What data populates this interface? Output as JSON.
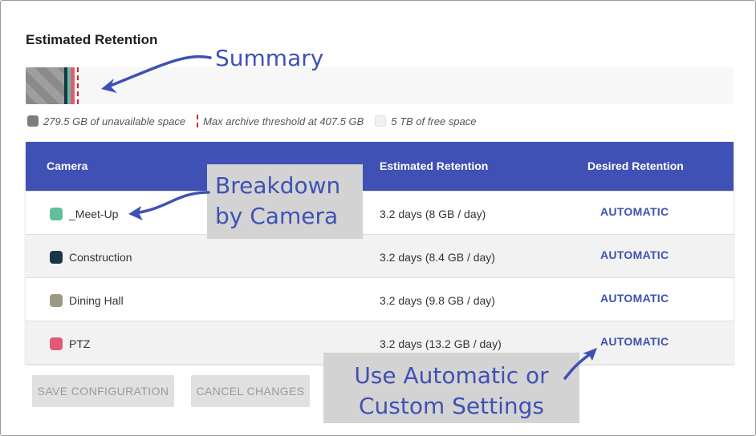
{
  "section_title": "Estimated Retention",
  "legend": {
    "unavailable": "279.5 GB of unavailable space",
    "threshold": "Max archive threshold at 407.5 GB",
    "free": "5 TB of free space"
  },
  "table": {
    "headers": {
      "camera": "Camera",
      "estimated": "Estimated Retention",
      "desired": "Desired Retention"
    },
    "rows": [
      {
        "name": "_Meet-Up",
        "color": "#5fbf9a",
        "estimated": "3.2 days (8 GB / day)",
        "desired": "AUTOMATIC"
      },
      {
        "name": "Construction",
        "color": "#1a3646",
        "estimated": "3.2 days (8.4 GB / day)",
        "desired": "AUTOMATIC"
      },
      {
        "name": "Dining Hall",
        "color": "#9a9a80",
        "estimated": "3.2 days (9.8 GB / day)",
        "desired": "AUTOMATIC"
      },
      {
        "name": "PTZ",
        "color": "#e05a77",
        "estimated": "3.2 days (13.2 GB / day)",
        "desired": "AUTOMATIC"
      }
    ]
  },
  "buttons": {
    "save": "SAVE CONFIGURATION",
    "cancel": "CANCEL CHANGES"
  },
  "callouts": {
    "summary": "Summary",
    "breakdown_line1": "Breakdown",
    "breakdown_line2": "by Camera",
    "auto_line1": "Use Automatic or",
    "auto_line2": "Custom Settings"
  },
  "colors": {
    "accent": "#3f51b5",
    "threshold": "#e02020",
    "callout_bg": "#d3d3d3"
  }
}
